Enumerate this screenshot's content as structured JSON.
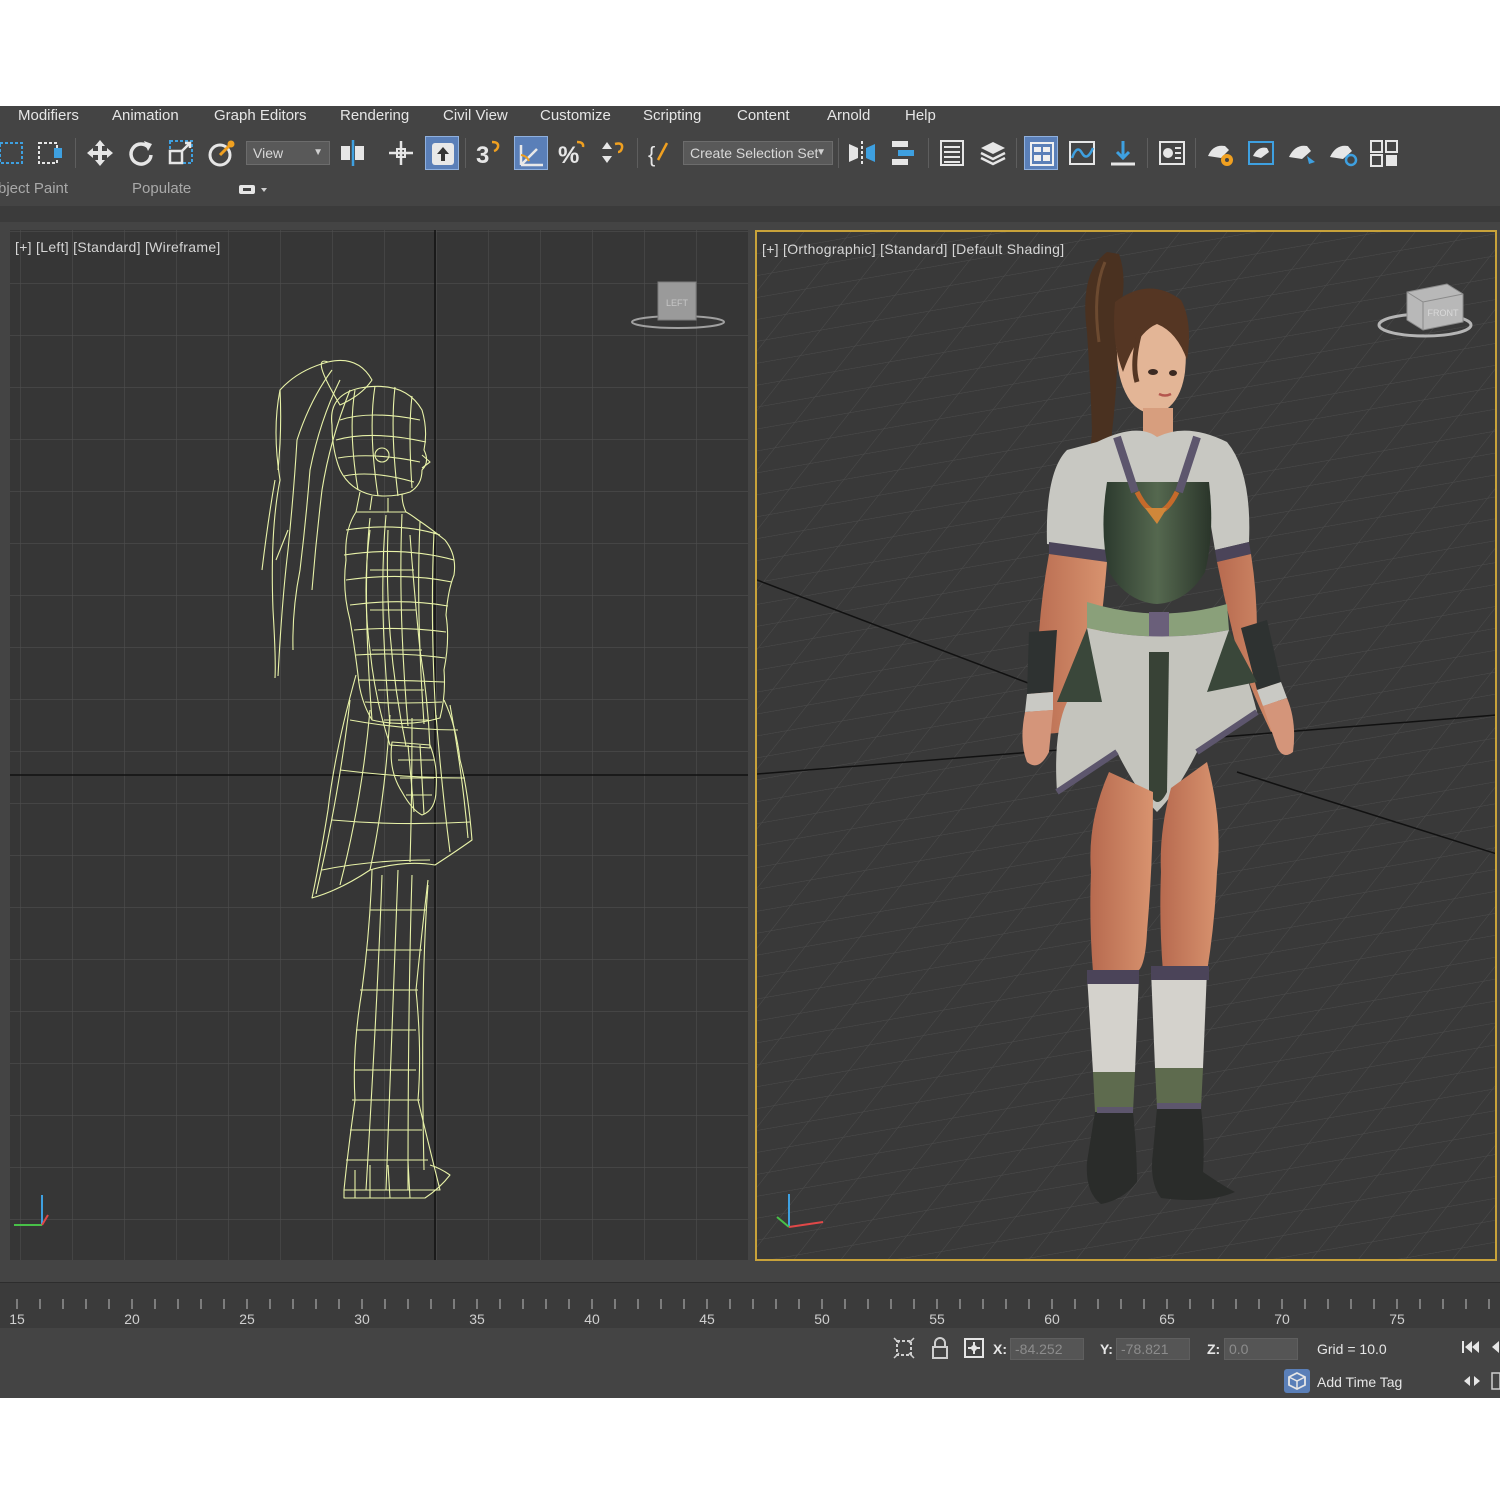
{
  "menu": [
    "Modifiers",
    "Animation",
    "Graph Editors",
    "Rendering",
    "Civil View",
    "Customize",
    "Scripting",
    "Content",
    "Arnold",
    "Help"
  ],
  "toolbar": {
    "view_dropdown": "View",
    "selection_set_dropdown": "Create Selection Set"
  },
  "ribbon": {
    "object_paint": "bject Paint",
    "populate": "Populate"
  },
  "viewports": {
    "left": {
      "label": "[+] [Left] [Standard] [Wireframe]",
      "viewcube_face": "LEFT",
      "wire_color": "#e8f2a8"
    },
    "right": {
      "label": "[+] [Orthographic] [Standard] [Default Shading]",
      "viewcube_face": "FRONT",
      "active_border_color": "#c8a23a"
    }
  },
  "timeline": {
    "labels": [
      "15",
      "20",
      "25",
      "30",
      "35",
      "40",
      "45",
      "50",
      "55",
      "60",
      "65",
      "70",
      "75"
    ]
  },
  "status": {
    "x_label": "X:",
    "x_value": "-84.252",
    "y_label": "Y:",
    "y_value": "-78.821",
    "z_label": "Z:",
    "z_value": "0.0",
    "grid": "Grid = 10.0",
    "add_time_tag": "Add Time Tag"
  },
  "colors": {
    "app_background": "#444444",
    "viewport_background": "#363636",
    "accent": "#5a7fb8"
  }
}
